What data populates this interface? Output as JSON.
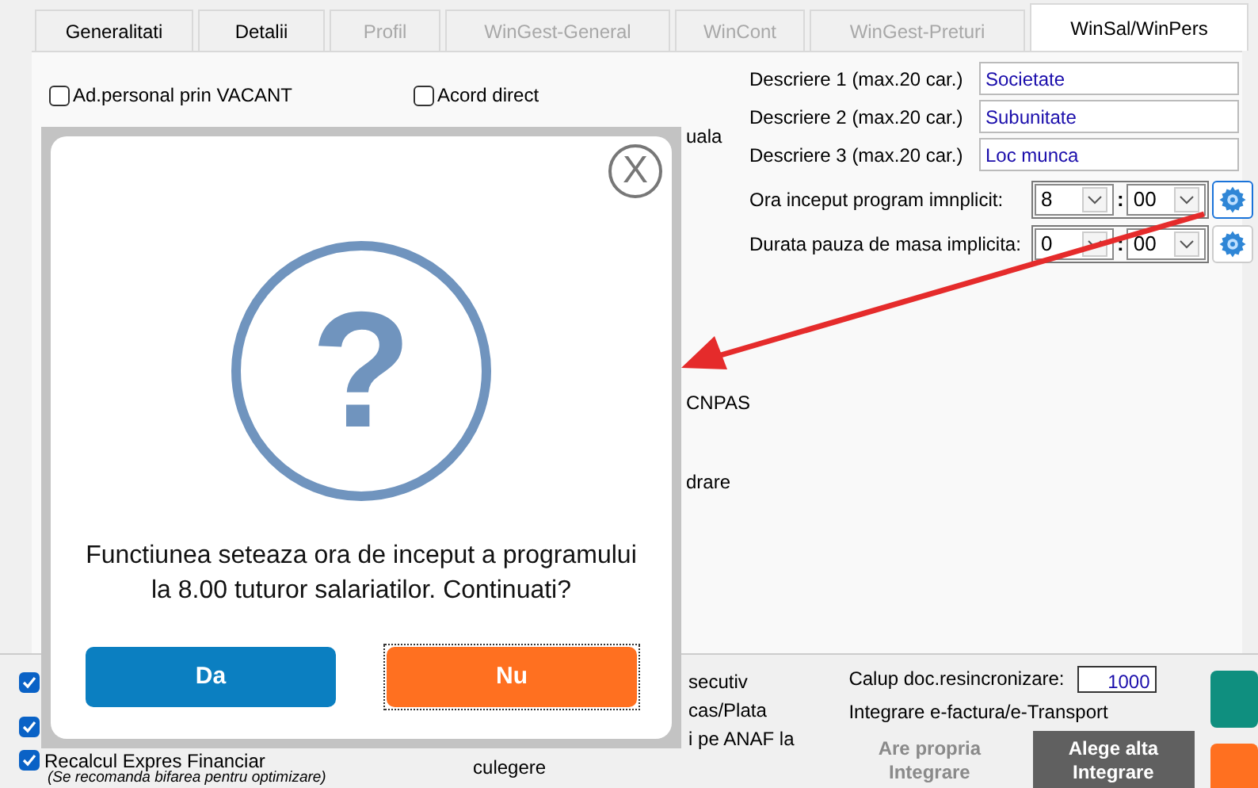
{
  "tabs": [
    {
      "label": "Generalitati",
      "selected": false,
      "disabled": false
    },
    {
      "label": "Detalii",
      "selected": false,
      "disabled": false
    },
    {
      "label": "Profil",
      "selected": false,
      "disabled": true
    },
    {
      "label": "WinGest-General",
      "selected": false,
      "disabled": true
    },
    {
      "label": "WinCont",
      "selected": false,
      "disabled": true
    },
    {
      "label": "WinGest-Preturi",
      "selected": false,
      "disabled": true
    },
    {
      "label": "WinSal/WinPers",
      "selected": true,
      "disabled": false
    }
  ],
  "options": [
    {
      "label": "Ad.personal prin VACANT",
      "checked": false
    },
    {
      "label": "Acord direct",
      "checked": false
    }
  ],
  "fragments": [
    "uala",
    "CNPAS",
    "drare"
  ],
  "descriptions": [
    {
      "label": "Descriere 1 (max.20 car.)",
      "value": "Societate"
    },
    {
      "label": "Descriere 2 (max.20 car.)",
      "value": "Subunitate"
    },
    {
      "label": "Descriere 3 (max.20 car.)",
      "value": "Loc munca"
    }
  ],
  "time_settings": [
    {
      "label": "Ora inceput program imnplicit:",
      "hours": "8",
      "separator": ":",
      "minutes": "00",
      "focused": true
    },
    {
      "label": "Durata pauza de masa implicita:",
      "hours": "0",
      "separator": ":",
      "minutes": "00",
      "focused": false
    }
  ],
  "bottom": {
    "left": [
      {
        "checked": true
      },
      {
        "checked": true
      },
      {
        "checked": true,
        "label": "Recalcul Expres Financiar"
      }
    ],
    "note": "(Se recomanda bifarea pentru optimizare)",
    "middle": [
      "secutiv",
      "cas/Plata",
      "i pe ANAF la",
      "culegere"
    ],
    "calup": {
      "label": "Calup doc.resincronizare:",
      "value": "1000"
    },
    "integration_label": "Integrare e-factura/e-Transport",
    "integration_buttons": [
      {
        "label": "Are propria Integrare",
        "kind": "flat"
      },
      {
        "label": "Alege alta Integrare",
        "kind": "dark"
      }
    ]
  },
  "dialog": {
    "close": "X",
    "icon": "?",
    "message": "Functiunea seteaza ora de inceput a programului la 8.00 tuturor salariatilor. Continuati?",
    "buttons": [
      {
        "label": "Da",
        "kind": "primary",
        "focused": false
      },
      {
        "label": "Nu",
        "kind": "warning",
        "focused": true
      }
    ]
  }
}
